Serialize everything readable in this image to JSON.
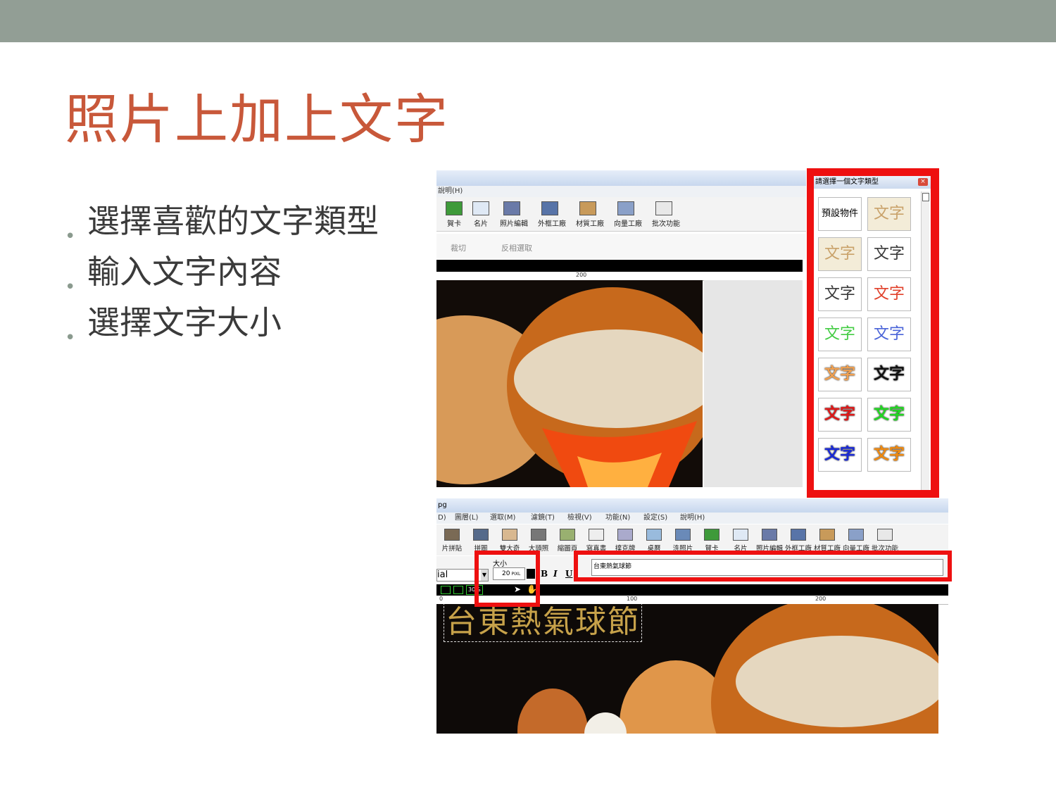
{
  "slide": {
    "title": "照片上加上文字",
    "bullets": [
      "選擇喜歡的文字類型",
      "輸入文字內容",
      "選擇文字大小"
    ]
  },
  "shot1": {
    "menu_help": "說明(H)",
    "toolbar": [
      "賀卡",
      "名片",
      "照片編輯",
      "外框工廠",
      "材質工廠",
      "向量工廠",
      "批次功能"
    ],
    "crop_label": "裁切",
    "invert_label": "反相選取",
    "ruler_mark": "200"
  },
  "text_type_panel": {
    "title": "請選擇一個文字類型",
    "default_label": "預設物件",
    "style_sample": "文字",
    "style_colors": [
      "#c9a26a",
      "#c9a26a",
      "#3a3a3a",
      "#3a3a3a",
      "#e0402a",
      "#44cc44",
      "#4a64d8",
      "#f0a050",
      "#111111",
      "#e01818",
      "#22d822",
      "#1a2ad8",
      "#f08a10"
    ]
  },
  "shot2": {
    "window_title": "pg",
    "menu": [
      "D)",
      "圖層(L)",
      "選取(M)",
      "濾鏡(T)",
      "檢視(V)",
      "功能(N)",
      "設定(S)",
      "說明(H)"
    ],
    "toolbar": [
      "片拼貼",
      "拼圖",
      "雙大奇",
      "大頭照",
      "縮圖頁",
      "寫真書",
      "撲克牌",
      "桌曆",
      "洗照片",
      "賀卡",
      "名片",
      "照片編輯",
      "外框工廠",
      "材質工廠",
      "向量工廠",
      "批次功能"
    ],
    "font_name": "ial",
    "size_label": "大小",
    "size_value": "20",
    "size_unit": "PIXL",
    "bold": "B",
    "italic": "I",
    "underline": "U",
    "text_input_value": "台東熱氣球節",
    "zoom": "30%",
    "ruler_marks": [
      "0",
      "100",
      "200"
    ],
    "overlay_text": "台東熱氣球節"
  }
}
